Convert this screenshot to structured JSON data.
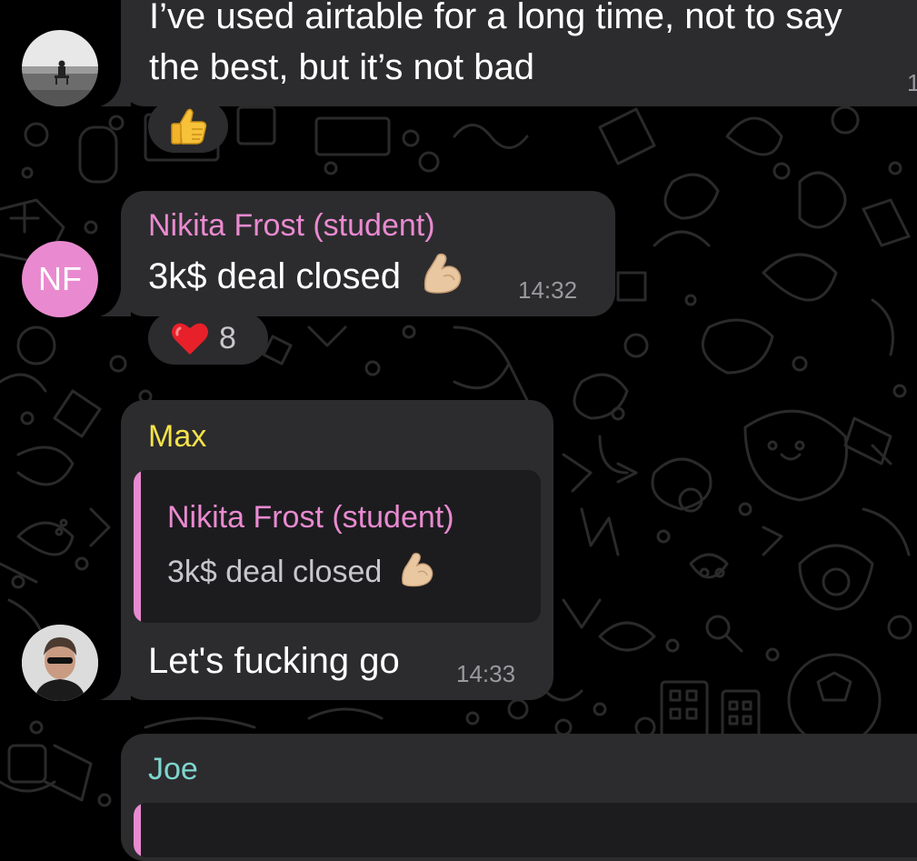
{
  "colors": {
    "background": "#000000",
    "bubble": "#2c2c2e",
    "quote_bg": "#1c1c1e",
    "nikita_name": "#e98ad0",
    "max_name": "#f5e24a",
    "joe_name": "#7fd6cf",
    "time": "#9a9a9e",
    "avatar_nf": "#e98ad0"
  },
  "messages": [
    {
      "id": "msg-airtable",
      "lines": [
        "I’ve used airtable for a long time, not to say",
        "the best, but it’s not bad"
      ],
      "time": "1",
      "reaction": {
        "emoji": "thumbs-up",
        "count": ""
      }
    },
    {
      "id": "msg-nikita",
      "sender": "Nikita Frost (student)",
      "text": "3k$ deal closed",
      "emoji": "flexed-biceps",
      "time": "14:32",
      "avatar_initials": "NF",
      "reaction": {
        "emoji": "red-heart",
        "count": "8"
      }
    },
    {
      "id": "msg-max",
      "sender": "Max",
      "reply": {
        "sender": "Nikita Frost (student)",
        "text": "3k$ deal closed",
        "emoji": "flexed-biceps"
      },
      "text": "Let's fucking go",
      "time": "14:33"
    },
    {
      "id": "msg-joe",
      "sender": "Joe"
    }
  ]
}
